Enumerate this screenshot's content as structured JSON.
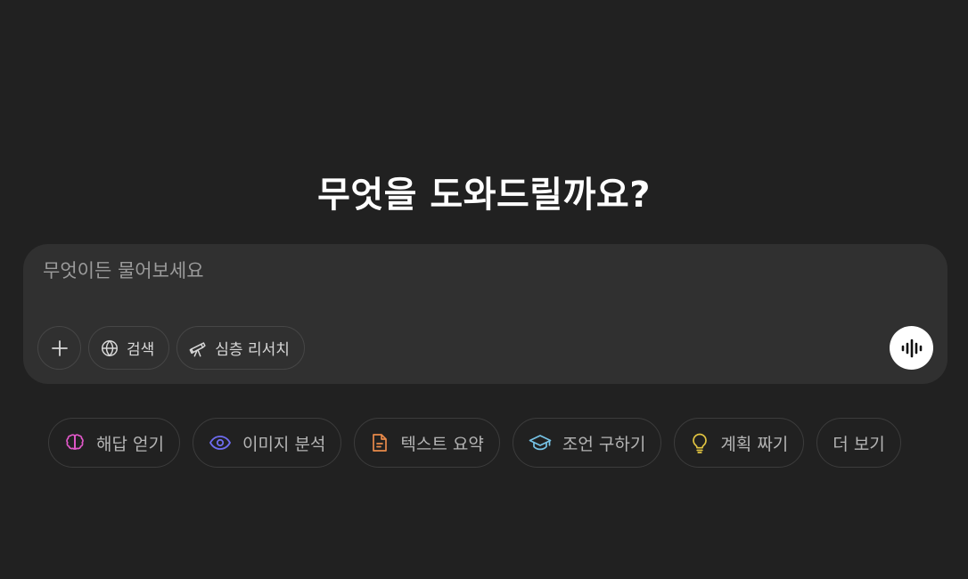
{
  "headline": "무엇을 도와드릴까요?",
  "composer": {
    "placeholder": "무엇이든 물어보세요",
    "tools": [
      {
        "label": "검색",
        "icon": "globe-icon"
      },
      {
        "label": "심층 리서치",
        "icon": "telescope-icon"
      }
    ],
    "add_icon": "plus-icon",
    "voice_icon": "voice-waveform-icon"
  },
  "suggestions": [
    {
      "label": "해답 얻기",
      "icon": "brain-icon",
      "color": "#e158c9"
    },
    {
      "label": "이미지 분석",
      "icon": "eye-icon",
      "color": "#6e6cf0"
    },
    {
      "label": "텍스트 요약",
      "icon": "document-icon",
      "color": "#e98a4a"
    },
    {
      "label": "조언 구하기",
      "icon": "graduation-cap-icon",
      "color": "#76c3e6"
    },
    {
      "label": "계획 짜기",
      "icon": "lightbulb-icon",
      "color": "#e2c541"
    },
    {
      "label": "더 보기",
      "icon": "",
      "color": ""
    }
  ],
  "colors": {
    "background": "#212121",
    "composer_bg": "#303030",
    "text": "#ececec",
    "muted_text": "#9b9b9b"
  }
}
